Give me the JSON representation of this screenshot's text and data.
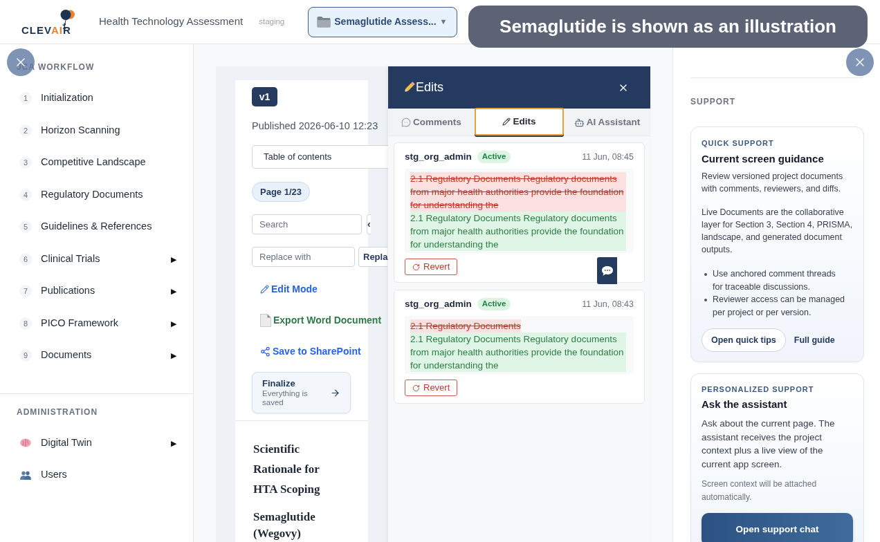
{
  "header": {
    "logo": {
      "text_parts": [
        "CLEV",
        "AI",
        "R"
      ]
    },
    "app_title": "Health Technology Assessment",
    "environment": "staging",
    "project_selector": {
      "label": "Semaglutide Assess...",
      "caret": "▼"
    }
  },
  "toast": {
    "text": "Semaglutide is shown as an illustration"
  },
  "sidebar": {
    "sections": [
      {
        "heading": "JCA WORKFLOW",
        "items": [
          {
            "kind": "numbered",
            "number": "1",
            "label": "Initialization"
          },
          {
            "kind": "numbered",
            "number": "2",
            "label": "Horizon Scanning"
          },
          {
            "kind": "numbered",
            "number": "3",
            "label": "Competitive Landscape"
          },
          {
            "kind": "numbered",
            "number": "4",
            "label": "Regulatory Documents"
          },
          {
            "kind": "numbered",
            "number": "5",
            "label": "Guidelines & References"
          },
          {
            "kind": "numbered",
            "number": "6",
            "label": "Clinical Trials",
            "arrow": "▶"
          },
          {
            "kind": "numbered",
            "number": "7",
            "label": "Publications",
            "arrow": "▶"
          },
          {
            "kind": "numbered",
            "number": "8",
            "label": "PICO Framework",
            "arrow": "▶"
          },
          {
            "kind": "numbered",
            "number": "9",
            "label": "Documents",
            "arrow": "▶"
          }
        ]
      },
      {
        "heading": "ADMINISTRATION",
        "items": [
          {
            "kind": "icon",
            "label": "Digital Twin",
            "arrow": "▶"
          },
          {
            "kind": "icon",
            "label": "Users"
          }
        ]
      }
    ]
  },
  "document": {
    "version": "v1",
    "published": "Published 2026-06-10 12:23",
    "toc_select": "Table of contents",
    "page_indicator": "Page 1/23",
    "search": {
      "placeholder": "Search"
    },
    "prev_button": "‹",
    "replace": {
      "placeholder": "Replace with"
    },
    "replace_button": "Repla",
    "actions": [
      {
        "kind": "edit",
        "label": "Edit Mode"
      },
      {
        "kind": "export",
        "label": "Export Word Document"
      },
      {
        "kind": "share",
        "label": "Save to SharePoint"
      }
    ],
    "finalize": {
      "title": "Finalize",
      "subtitle": "Everything is saved"
    },
    "headings": [
      "Scientific Rationale for HTA Scoping",
      "Semaglutide (Wegovy)"
    ]
  },
  "edits_panel": {
    "title": "Edits",
    "tabs": [
      {
        "label": "Comments",
        "selected": false
      },
      {
        "label": "Edits",
        "selected": true
      },
      {
        "label": "AI Assistant",
        "selected": false
      }
    ],
    "edits": [
      {
        "user": "stg_org_admin",
        "status": "Active",
        "time": "11 Jun, 08:45",
        "removed": "2.1 Regulatory Documents Regulatory documents from major health authorities provide the foundation for understanding the",
        "added": "2.1 Regulatory Documents Regulatory documents from major health authorities provide the foundation for understanding the",
        "action": "Revert"
      },
      {
        "user": "stg_org_admin",
        "status": "Active",
        "time": "11 Jun, 08:43",
        "removed": "2.1 Regulatory Documents",
        "added": "2.1 Regulatory Documents Regulatory documents from major health authorities provide the foundation for understanding the",
        "action": "Revert"
      }
    ]
  },
  "support": {
    "heading": "SUPPORT",
    "cards": [
      {
        "eyebrow": "QUICK SUPPORT",
        "title": "Current screen guidance",
        "paragraphs": [
          "Review versioned project documents with comments, reviewers, and diffs.",
          "Live Documents are the collaborative layer for Section 3, Section 4, PRISMA, landscape, and generated document outputs."
        ],
        "bullets": [
          "Use anchored comment threads for traceable discussions.",
          "Reviewer access can be managed per project or per version."
        ],
        "buttons": [
          {
            "kind": "outline",
            "label": "Open quick tips"
          },
          {
            "kind": "link",
            "label": "Full guide"
          }
        ]
      },
      {
        "eyebrow": "PERSONALIZED SUPPORT",
        "title": "Ask the assistant",
        "paragraphs": [
          "Ask about the current page. The assistant receives the project context plus a live view of the current app screen."
        ],
        "note": "Screen context will be attached automatically.",
        "buttons": [
          {
            "kind": "primary",
            "label": "Open support chat"
          }
        ]
      }
    ]
  }
}
